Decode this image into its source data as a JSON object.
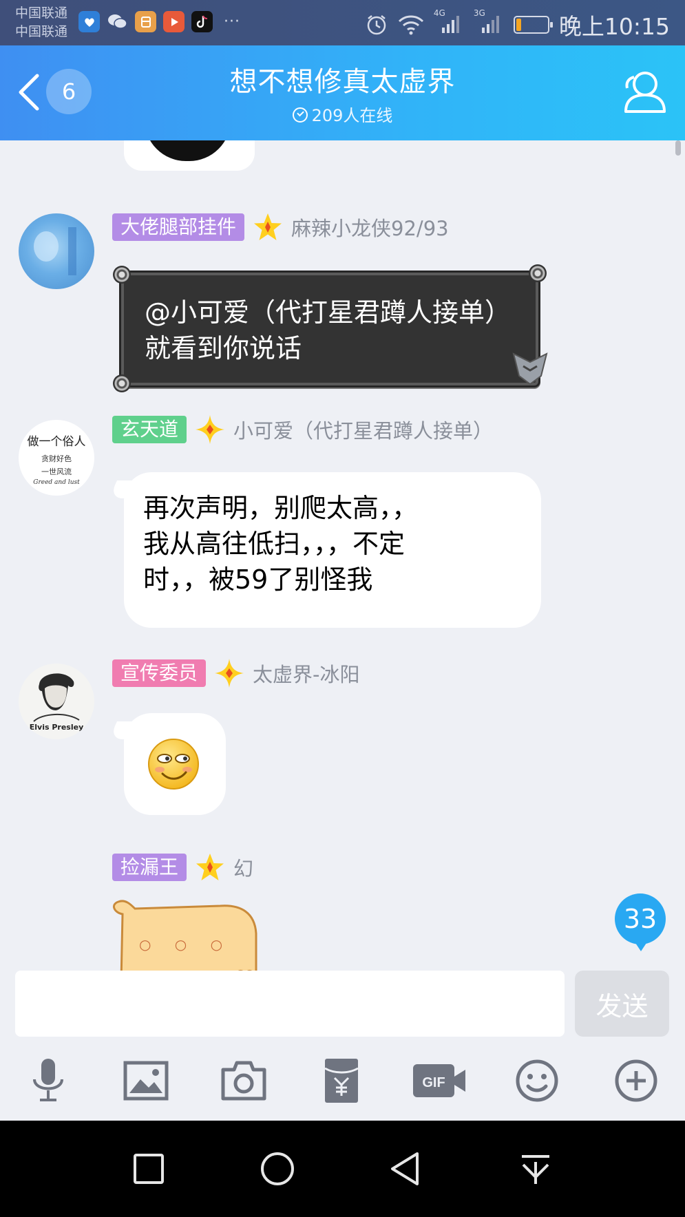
{
  "status_bar": {
    "carrier_1": "中国联通",
    "carrier_2": "中国联通",
    "network_1": "4G",
    "network_2": "3G",
    "more": "···",
    "time": "晚上10:15",
    "icons": [
      "qq-icon",
      "wechat-icon",
      "app-icon",
      "video-icon",
      "tiktok-icon",
      "alarm-icon",
      "wifi-icon",
      "battery-icon"
    ],
    "battery_level": 0.15
  },
  "header": {
    "unread_count": "6",
    "title": "想不想修真太虚界",
    "online": "209人在线"
  },
  "messages": [
    {
      "tag": "大佬腿部挂件",
      "tag_color": "#b38ce6",
      "nick": "麻辣小龙侠92/93",
      "text": "@小可爱（代打星君蹲人接单）就看到你说话"
    },
    {
      "tag": "玄天道",
      "tag_color": "#5fd08c",
      "nick": "小可爱（代打星君蹲人接单）",
      "avatar_text": [
        "做一个俗人",
        "贪财好色",
        "一世风流",
        "Greed and lust"
      ],
      "text_lines": [
        "再次声明，别爬太高，，",
        "我从高往低扫，，，不定",
        "时，，被59了别怪我"
      ]
    },
    {
      "tag": "宣传委员",
      "tag_color": "#f07cb0",
      "nick": "太虚界-冰阳",
      "avatar_text": [
        "Elvis Presley"
      ],
      "emoji": "smirk-emoji"
    },
    {
      "tag": "捡漏王",
      "tag_color": "#b38ce6",
      "nick": "幻",
      "sticker_text": "○ ○ ○"
    }
  ],
  "new_messages_count": "33",
  "input": {
    "placeholder": "",
    "send_label": "发送"
  },
  "toolbar": [
    "mic-icon",
    "image-icon",
    "camera-icon",
    "red-packet-icon",
    "gif-icon",
    "emoji-icon",
    "plus-icon"
  ],
  "nav": [
    "recent-apps-icon",
    "home-icon",
    "back-icon",
    "notification-icon"
  ]
}
